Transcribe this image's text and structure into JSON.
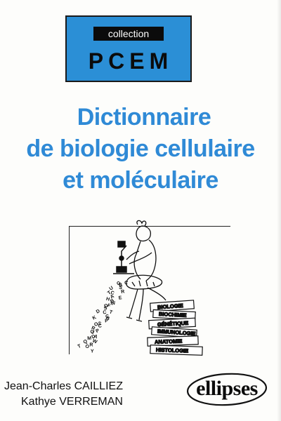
{
  "collection": {
    "label": "collection",
    "series": "PCEM"
  },
  "title": {
    "line1": "Dictionnaire",
    "line2": "de biologie cellulaire",
    "line3": "et moléculaire"
  },
  "illustration": {
    "book_labels": [
      "BIOLOGIE",
      "BIOCHIMIE",
      "GÉNÉTIQUE",
      "IMMUNOLOGIE",
      "ANATOMIE",
      "HISTOLOGIE"
    ],
    "scattered_letters": [
      "G",
      "C",
      "B",
      "U",
      "S",
      "R",
      "T",
      "C",
      "E",
      "A",
      "H",
      "W",
      "B",
      "F",
      "S",
      "D",
      "T",
      "C",
      "D",
      "B",
      "C",
      "K",
      "S",
      "P",
      "O",
      "R",
      "C",
      "P",
      "J",
      "G",
      "D",
      "A",
      "M",
      "Q",
      "W",
      "R",
      "T",
      "O",
      "Y"
    ]
  },
  "authors": {
    "first": "Jean-Charles CAILLIEZ",
    "second": "Kathye VERREMAN"
  },
  "publisher": {
    "name": "ellipses"
  },
  "colors": {
    "accent_blue": "#2b8fd6",
    "title_blue": "#2f8ad6",
    "ink": "#0b0b0b"
  }
}
